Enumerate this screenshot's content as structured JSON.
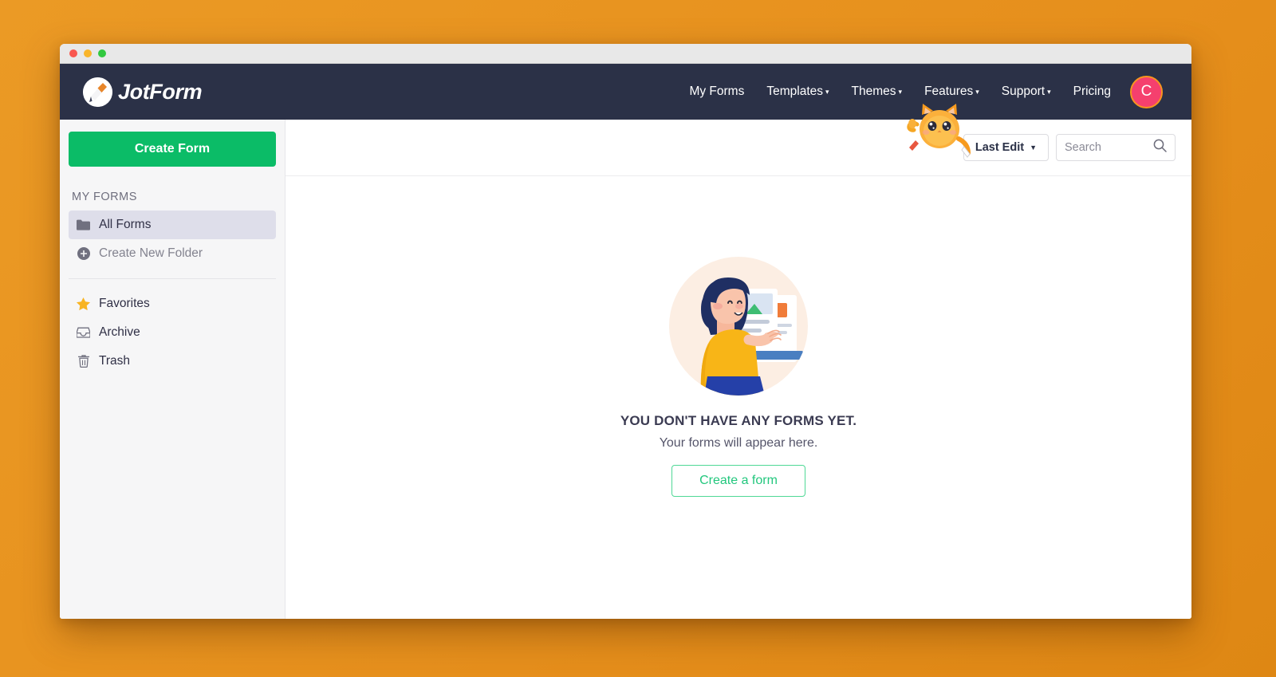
{
  "window": {
    "traffic_lights": [
      "close",
      "minimize",
      "zoom"
    ]
  },
  "header": {
    "brand": "JotForm",
    "logo_icon": "pencil-circle-icon",
    "nav": [
      {
        "label": "My Forms",
        "has_caret": false
      },
      {
        "label": "Templates",
        "has_caret": true
      },
      {
        "label": "Themes",
        "has_caret": true
      },
      {
        "label": "Features",
        "has_caret": true
      },
      {
        "label": "Support",
        "has_caret": true
      },
      {
        "label": "Pricing",
        "has_caret": false
      }
    ],
    "avatar_initial": "C",
    "caret_glyph": "▾"
  },
  "sidebar": {
    "create_form_label": "Create Form",
    "section_label": "MY FORMS",
    "folders": [
      {
        "label": "All Forms",
        "icon": "folder-icon",
        "active": true
      },
      {
        "label": "Create New Folder",
        "icon": "plus-circle-icon",
        "active": false
      }
    ],
    "items": [
      {
        "label": "Favorites",
        "icon": "star-icon"
      },
      {
        "label": "Archive",
        "icon": "archive-icon"
      },
      {
        "label": "Trash",
        "icon": "trash-icon"
      }
    ]
  },
  "toolbar": {
    "sort_label": "Last Edit",
    "sort_caret": "▼",
    "search_placeholder": "Search",
    "search_value": "",
    "search_icon": "search-icon",
    "mascot_icon": "cat-mascot-icon"
  },
  "empty_state": {
    "illustration": "woman-presenting-forms-illustration",
    "title": "YOU DON'T HAVE ANY FORMS YET.",
    "subtitle": "Your forms will appear here.",
    "button_label": "Create a form"
  },
  "colors": {
    "page_background": "#e8941f",
    "header_background": "#2b3147",
    "primary_green": "#0bbc67",
    "outline_green": "#22c77d",
    "sidebar_background": "#f6f6f7",
    "active_item": "#dedeea",
    "avatar_pink": "#f5406e",
    "avatar_ring": "#f7961e",
    "star_yellow": "#f8b422"
  }
}
